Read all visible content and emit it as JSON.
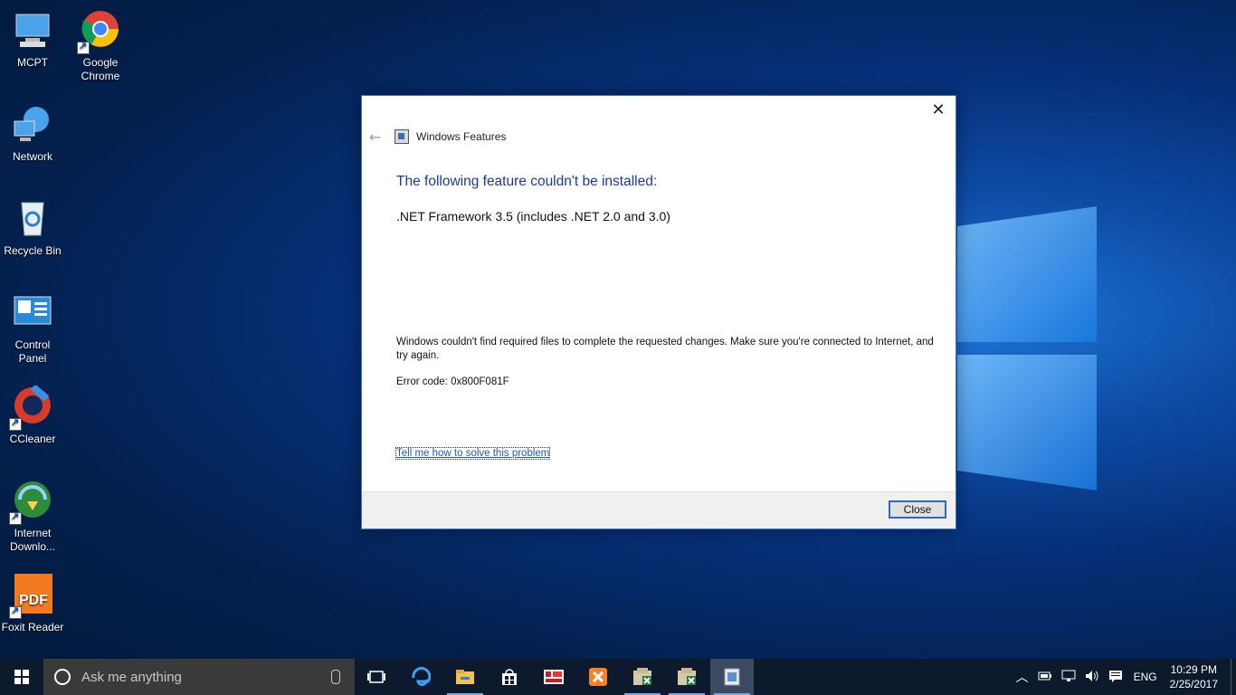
{
  "desktop": {
    "icons": [
      {
        "label": "MCPT",
        "icon": "computer-icon"
      },
      {
        "label": "Google Chrome",
        "icon": "chrome-icon"
      },
      {
        "label": "Network",
        "icon": "network-icon"
      },
      {
        "label": "Recycle Bin",
        "icon": "recycle-bin-icon"
      },
      {
        "label": "Control Panel",
        "icon": "control-panel-icon"
      },
      {
        "label": "CCleaner",
        "icon": "ccleaner-icon"
      },
      {
        "label": "Internet Downlo...",
        "icon": "idm-icon"
      },
      {
        "label": "Foxit Reader",
        "icon": "foxit-icon"
      }
    ]
  },
  "dialog": {
    "title": "Windows Features",
    "heading": "The following feature couldn't be installed:",
    "feature": ".NET Framework 3.5 (includes .NET 2.0 and 3.0)",
    "message": "Windows couldn't find required files to complete the requested changes. Make sure you're connected to Internet, and try again.",
    "error_code": "Error code: 0x800F081F",
    "help_link": "Tell me how to solve this problem",
    "close_button": "Close"
  },
  "taskbar": {
    "search_placeholder": "Ask me anything",
    "apps": [
      "task-view-icon",
      "edge-icon",
      "file-explorer-icon",
      "store-icon",
      "filezilla-icon",
      "xampp-icon",
      "excel-file-icon",
      "excel-file-icon",
      "windows-features-icon"
    ],
    "language": "ENG",
    "time": "10:29 PM",
    "date": "2/25/2017"
  },
  "colors": {
    "accent": "#1a3a9a",
    "link": "#1c5cb8",
    "taskbar": "#0d1a2e"
  }
}
